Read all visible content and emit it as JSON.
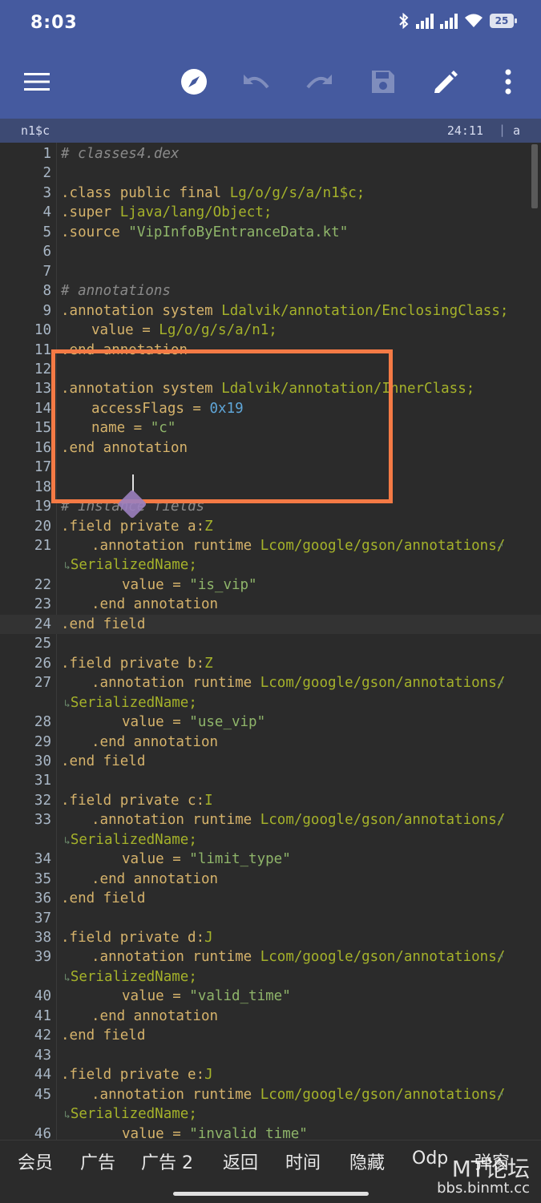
{
  "status_bar": {
    "time": "8:03",
    "battery": "25"
  },
  "toolbar": {
    "menu_icon": "hamburger-menu-icon",
    "icons": [
      "compass-icon",
      "undo-icon",
      "redo-icon",
      "save-icon",
      "edit-icon",
      "more-vert-icon"
    ]
  },
  "file_bar": {
    "filename": "n1$c",
    "cursor_position": "24:11",
    "separator": "|",
    "mode": "a"
  },
  "editor": {
    "current_line": "24",
    "lines": [
      {
        "n": "1",
        "text": "# classes4.dex"
      },
      {
        "n": "2",
        "text": ""
      },
      {
        "n": "3",
        "a": ".class public final ",
        "b": "Lg/o/g/s/a/n1$c;"
      },
      {
        "n": "4",
        "a": ".super ",
        "b": "Ljava/lang/Object;"
      },
      {
        "n": "5",
        "a": ".source ",
        "b": "\"VipInfoByEntranceData.kt\""
      },
      {
        "n": "6",
        "text": ""
      },
      {
        "n": "7",
        "text": ""
      },
      {
        "n": "8",
        "text": "# annotations"
      },
      {
        "n": "9",
        "a": ".annotation system ",
        "b": "Ldalvik/annotation/EnclosingClass;"
      },
      {
        "n": "10",
        "a": "value = ",
        "b": "Lg/o/g/s/a/n1;"
      },
      {
        "n": "11",
        "a": ".end annotation"
      },
      {
        "n": "12",
        "text": ""
      },
      {
        "n": "13",
        "a": ".annotation system ",
        "b": "Ldalvik/annotation/InnerClass;"
      },
      {
        "n": "14",
        "a": "accessFlags = ",
        "b": "0x19"
      },
      {
        "n": "15",
        "a": "name = ",
        "b": "\"c\""
      },
      {
        "n": "16",
        "a": ".end annotation"
      },
      {
        "n": "17",
        "text": ""
      },
      {
        "n": "18",
        "text": ""
      },
      {
        "n": "19",
        "text": "# instance fields"
      },
      {
        "n": "20",
        "a": ".field private a:",
        "b": "Z"
      },
      {
        "n": "21",
        "a": ".annotation runtime ",
        "b": "Lcom/google/gson/annotations/",
        "wrap": "SerializedName;"
      },
      {
        "n": "22",
        "a": "value = ",
        "b": "\"is_vip\""
      },
      {
        "n": "23",
        "a": ".end annotation"
      },
      {
        "n": "24",
        "a": ".end field"
      },
      {
        "n": "25",
        "text": ""
      },
      {
        "n": "26",
        "a": ".field private b:",
        "b": "Z"
      },
      {
        "n": "27",
        "a": ".annotation runtime ",
        "b": "Lcom/google/gson/annotations/",
        "wrap": "SerializedName;"
      },
      {
        "n": "28",
        "a": "value = ",
        "b": "\"use_vip\""
      },
      {
        "n": "29",
        "a": ".end annotation"
      },
      {
        "n": "30",
        "a": ".end field"
      },
      {
        "n": "31",
        "text": ""
      },
      {
        "n": "32",
        "a": ".field private c:",
        "b": "I"
      },
      {
        "n": "33",
        "a": ".annotation runtime ",
        "b": "Lcom/google/gson/annotations/",
        "wrap": "SerializedName;"
      },
      {
        "n": "34",
        "a": "value = ",
        "b": "\"limit_type\""
      },
      {
        "n": "35",
        "a": ".end annotation"
      },
      {
        "n": "36",
        "a": ".end field"
      },
      {
        "n": "37",
        "text": ""
      },
      {
        "n": "38",
        "a": ".field private d:",
        "b": "J"
      },
      {
        "n": "39",
        "a": ".annotation runtime ",
        "b": "Lcom/google/gson/annotations/",
        "wrap": "SerializedName;"
      },
      {
        "n": "40",
        "a": "value = ",
        "b": "\"valid_time\""
      },
      {
        "n": "41",
        "a": ".end annotation"
      },
      {
        "n": "42",
        "a": ".end field"
      },
      {
        "n": "43",
        "text": ""
      },
      {
        "n": "44",
        "a": ".field private e:",
        "b": "J"
      },
      {
        "n": "45",
        "a": ".annotation runtime ",
        "b": "Lcom/google/gson/annotations/",
        "wrap": "SerializedName;"
      },
      {
        "n": "46",
        "a": "value = ",
        "b": "\"invalid_time\""
      }
    ]
  },
  "bottom_bar": {
    "buttons": [
      "会员",
      "广告",
      "广告 2",
      "返回",
      "时间",
      "隐藏",
      "Odp",
      "弹窗"
    ]
  },
  "watermark": {
    "line1": "MT论坛",
    "line2": "bbs.binmt.cc"
  },
  "colors": {
    "appbar": "#455a9f",
    "filebar": "#3d4a73",
    "editor_bg": "#2b2b2b",
    "highlight_box": "#f47a45",
    "type": "#a5b22a",
    "string": "#8fb56a",
    "number": "#5fa6d8"
  }
}
